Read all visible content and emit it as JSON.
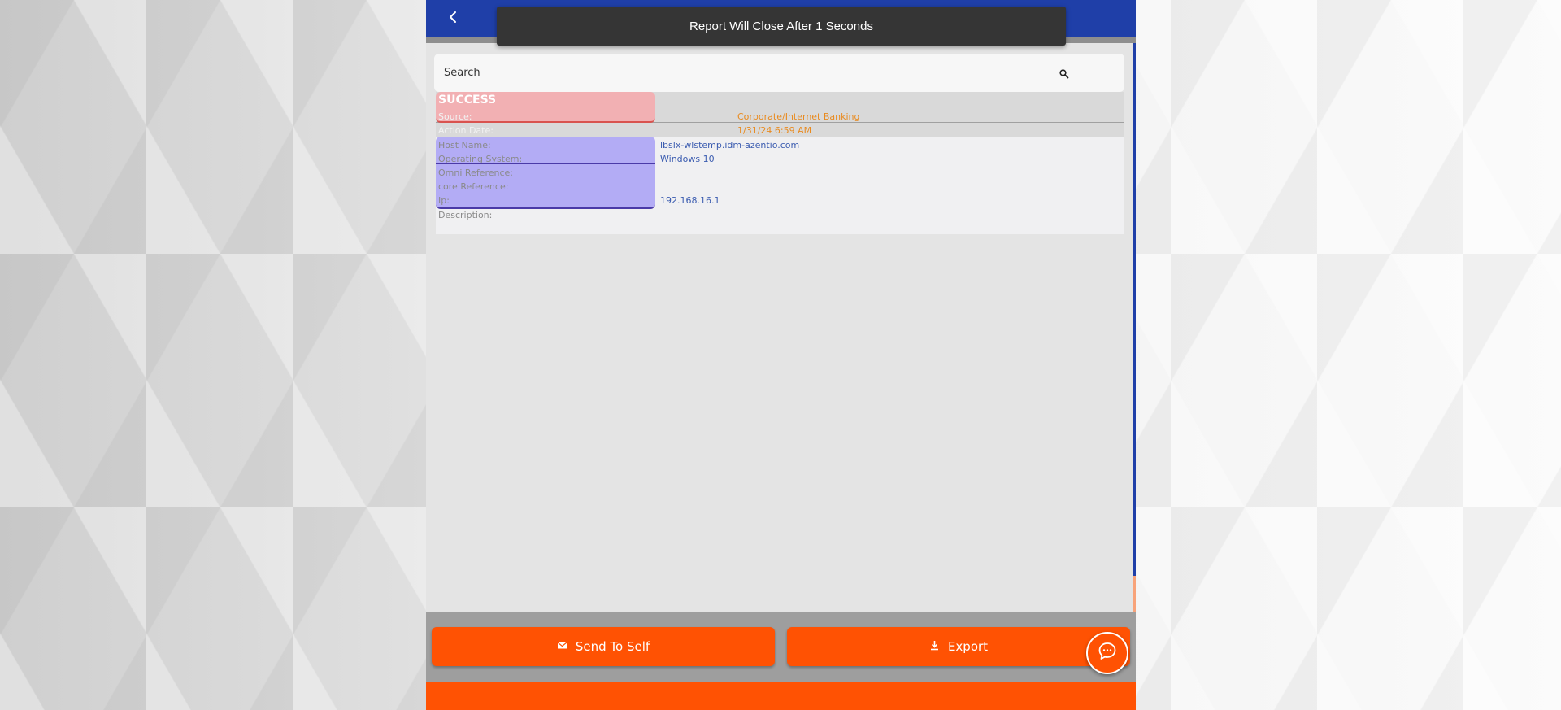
{
  "toast": {
    "message": "Report Will Close After 1 Seconds"
  },
  "search": {
    "placeholder": "Search"
  },
  "record": {
    "status": "SUCCESS",
    "fields": [
      {
        "label": "Source:",
        "value": "Corporate/Internet Banking"
      },
      {
        "label": "Action Date:",
        "value": "1/31/24 6:59 AM"
      },
      {
        "label": "Host Name:",
        "value": "lbslx-wlstemp.idm-azentio.com"
      },
      {
        "label": "Operating System:",
        "value": "Windows 10"
      },
      {
        "label": "Omni Reference:",
        "value": ""
      },
      {
        "label": "core Reference:",
        "value": ""
      },
      {
        "label": "Ip:",
        "value": "192.168.16.1"
      },
      {
        "label": "Description:",
        "value": ""
      }
    ]
  },
  "actions": {
    "send_label": "Send To Self",
    "send_icon": "mail-icon",
    "export_label": "Export",
    "export_icon": "download-icon"
  },
  "icons": {
    "back": "chevron-left-icon",
    "search": "search-icon",
    "chat": "chat-icon"
  },
  "colors": {
    "header": "#1f3fa8",
    "accent": "#ff5203",
    "toast": "#353535",
    "success_highlight": "#f2b0b3",
    "detail_highlight": "#b3acf5"
  }
}
